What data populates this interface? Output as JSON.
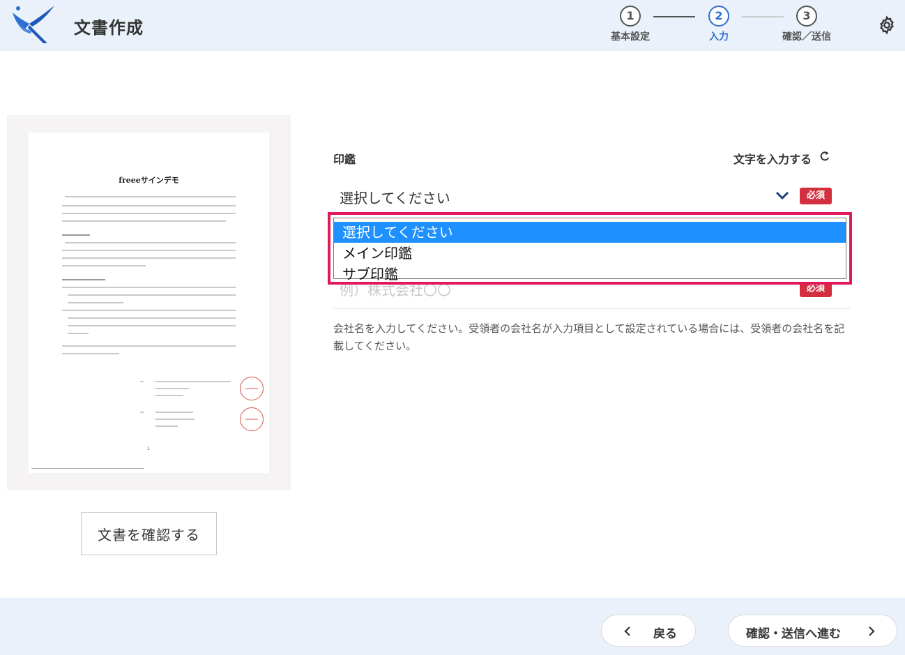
{
  "header": {
    "app_title": "文書作成",
    "steps": [
      {
        "number": "1",
        "label": "基本設定"
      },
      {
        "number": "2",
        "label": "入力"
      },
      {
        "number": "3",
        "label": "確認／送信"
      }
    ],
    "active_step": 2
  },
  "preview": {
    "doc_title": "freeeサインデモ",
    "page_number": "1",
    "confirm_button": "文書を確認する"
  },
  "form": {
    "stamp_label": "印鑑",
    "text_input_link": "文字を入力する",
    "select_value": "選択してください",
    "required_badge": "必須",
    "company_placeholder": "例）株式会社〇〇",
    "company_required_badge": "必須",
    "help_text": "会社名を入力してください。受領者の会社名が入力項目として設定されている場合には、受領者の会社名を記載してください。"
  },
  "dropdown": {
    "options": [
      "選択してください",
      "メイン印鑑",
      "サブ印鑑"
    ],
    "selected_index": 0
  },
  "footer": {
    "back_label": "戻る",
    "next_label": "確認・送信へ進む"
  },
  "colors": {
    "header_bg": "#eaf1fa",
    "accent_blue": "#2f6fd1",
    "required_red": "#d32f3f",
    "highlight_pink": "#e0195a",
    "selected_option": "#1e90ff"
  }
}
